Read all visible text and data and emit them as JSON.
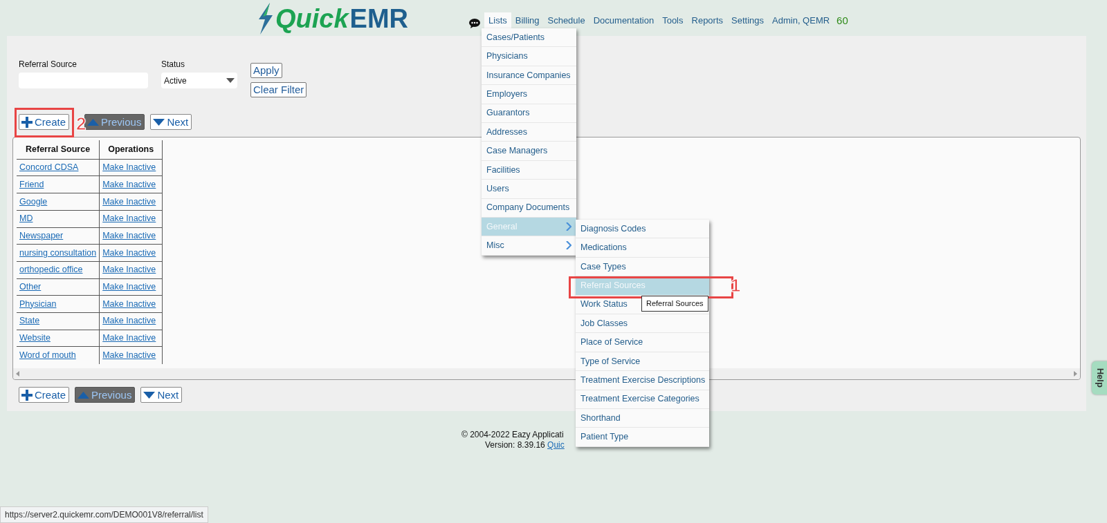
{
  "header": {
    "logo": {
      "part1": "Quick",
      "part2": "EMR"
    },
    "nav": [
      {
        "label": "Lists",
        "selected": true
      },
      {
        "label": "Billing",
        "selected": false
      },
      {
        "label": "Schedule",
        "selected": false
      },
      {
        "label": "Documentation",
        "selected": false
      },
      {
        "label": "Tools",
        "selected": false
      },
      {
        "label": "Reports",
        "selected": false
      },
      {
        "label": "Settings",
        "selected": false
      },
      {
        "label": "Admin, QEMR",
        "selected": false
      }
    ],
    "counter": "60"
  },
  "filters": {
    "fields": [
      {
        "label": "Referral Source",
        "kind": "text"
      },
      {
        "label": "Status",
        "kind": "select",
        "value": "Active"
      }
    ],
    "buttons": [
      "Apply",
      "Clear Filter"
    ]
  },
  "pager_top": [
    {
      "label": "Create",
      "kind": "create",
      "disabled": false
    },
    {
      "label": "Previous",
      "kind": "previous",
      "disabled": true
    },
    {
      "label": "Next",
      "kind": "next",
      "disabled": false
    }
  ],
  "table": {
    "columns": [
      "Referral Source",
      "Operations"
    ],
    "rows": [
      {
        "source": "Concord CDSA",
        "operation": "Make Inactive"
      },
      {
        "source": "Friend",
        "operation": "Make Inactive"
      },
      {
        "source": "Google",
        "operation": "Make Inactive"
      },
      {
        "source": "MD",
        "operation": "Make Inactive"
      },
      {
        "source": "Newspaper",
        "operation": "Make Inactive"
      },
      {
        "source": "nursing consultation",
        "operation": "Make Inactive"
      },
      {
        "source": "orthopedic office",
        "operation": "Make Inactive"
      },
      {
        "source": "Other",
        "operation": "Make Inactive"
      },
      {
        "source": "Physician",
        "operation": "Make Inactive"
      },
      {
        "source": "State",
        "operation": "Make Inactive"
      },
      {
        "source": "Website",
        "operation": "Make Inactive"
      },
      {
        "source": "Word of mouth",
        "operation": "Make Inactive"
      }
    ]
  },
  "pager_bottom": [
    {
      "label": "Create",
      "kind": "create",
      "disabled": false
    },
    {
      "label": "Previous",
      "kind": "previous",
      "disabled": true
    },
    {
      "label": "Next",
      "kind": "next",
      "disabled": false
    }
  ],
  "footer": {
    "copyright": "© 2004-2022 Eazy Applicati",
    "version": "Version: 8.39.16",
    "link": "Quic"
  },
  "menu": {
    "items": [
      {
        "label": "Cases/Patients",
        "submenu": false,
        "selected": false
      },
      {
        "label": "Physicians",
        "submenu": false,
        "selected": false
      },
      {
        "label": "Insurance Companies",
        "submenu": false,
        "selected": false
      },
      {
        "label": "Employers",
        "submenu": false,
        "selected": false
      },
      {
        "label": "Guarantors",
        "submenu": false,
        "selected": false
      },
      {
        "label": "Addresses",
        "submenu": false,
        "selected": false
      },
      {
        "label": "Case Managers",
        "submenu": false,
        "selected": false
      },
      {
        "label": "Facilities",
        "submenu": false,
        "selected": false
      },
      {
        "label": "Users",
        "submenu": false,
        "selected": false
      },
      {
        "label": "Company Documents",
        "submenu": false,
        "selected": false
      },
      {
        "label": "General",
        "submenu": true,
        "selected": true
      },
      {
        "label": "Misc",
        "submenu": true,
        "selected": false
      }
    ]
  },
  "submenu": {
    "items": [
      {
        "label": "Diagnosis Codes",
        "selected": false
      },
      {
        "label": "Medications",
        "selected": false
      },
      {
        "label": "Case Types",
        "selected": false
      },
      {
        "label": "Referral Sources",
        "selected": true
      },
      {
        "label": "Work Status",
        "selected": false
      },
      {
        "label": "Job Classes",
        "selected": false
      },
      {
        "label": "Place of Service",
        "selected": false
      },
      {
        "label": "Type of Service",
        "selected": false
      },
      {
        "label": "Treatment Exercise Descriptions",
        "selected": false
      },
      {
        "label": "Treatment Exercise Categories",
        "selected": false
      },
      {
        "label": "Shorthand",
        "selected": false
      },
      {
        "label": "Patient Type",
        "selected": false
      }
    ]
  },
  "tooltip": "Referral Sources",
  "annotations": [
    {
      "label": "1"
    },
    {
      "label": "2"
    }
  ],
  "help_tab": "Help",
  "status_url": "https://server2.quickemr.com/DEMO001V8/referral/list"
}
